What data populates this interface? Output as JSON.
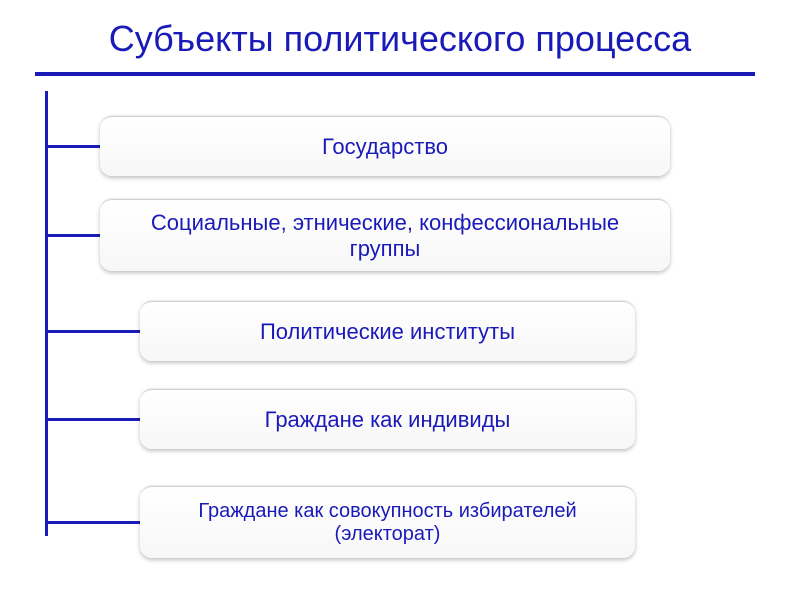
{
  "title": "Субъекты политического процесса",
  "nodes": {
    "n1": "Государство",
    "n2": "Социальные, этнические, конфессиональные группы",
    "n3": "Политические институты",
    "n4": "Граждане как индивиды",
    "n5": "Граждане как совокупность избирателей (электорат)"
  }
}
